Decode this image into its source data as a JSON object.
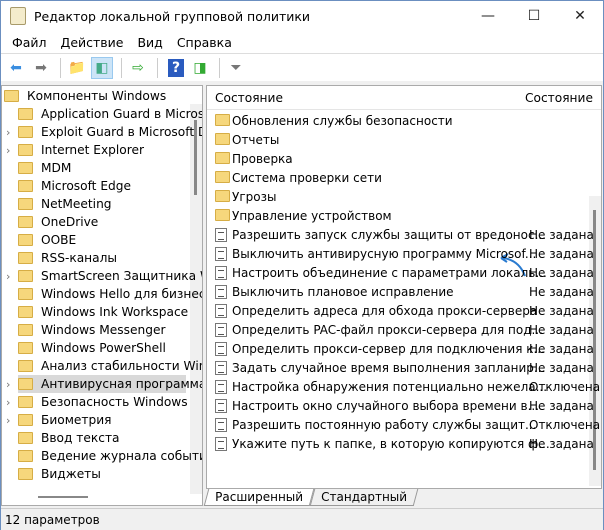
{
  "window": {
    "title": "Редактор локальной групповой политики"
  },
  "menu": [
    "Файл",
    "Действие",
    "Вид",
    "Справка"
  ],
  "toolbar": [
    "back-icon",
    "forward-icon",
    "up-folder-icon",
    "show-hide-tree-icon",
    "export-list-icon",
    "help-icon",
    "show-hide-action-pane-icon",
    "filter-icon"
  ],
  "tree": {
    "root": "Компоненты Windows",
    "items": [
      {
        "label": "Application Guard в Microsoft Defender",
        "expandable": false
      },
      {
        "label": "Exploit Guard в Microsoft Defender",
        "expandable": true
      },
      {
        "label": "Internet Explorer",
        "expandable": true
      },
      {
        "label": "MDM",
        "expandable": false
      },
      {
        "label": "Microsoft Edge",
        "expandable": false
      },
      {
        "label": "NetMeeting",
        "expandable": false
      },
      {
        "label": "OneDrive",
        "expandable": false
      },
      {
        "label": "OOBE",
        "expandable": false
      },
      {
        "label": "RSS-каналы",
        "expandable": false
      },
      {
        "label": "SmartScreen Защитника Windows",
        "expandable": true
      },
      {
        "label": "Windows Hello для бизнеса",
        "expandable": false
      },
      {
        "label": "Windows Ink Workspace",
        "expandable": false
      },
      {
        "label": "Windows Messenger",
        "expandable": false
      },
      {
        "label": "Windows PowerShell",
        "expandable": false
      },
      {
        "label": "Анализ стабильности Windows",
        "expandable": false
      },
      {
        "label": "Антивирусная программа",
        "expandable": true,
        "selected": true
      },
      {
        "label": "Безопасность Windows",
        "expandable": true
      },
      {
        "label": "Биометрия",
        "expandable": true
      },
      {
        "label": "Ввод текста",
        "expandable": false
      },
      {
        "label": "Ведение журнала событий",
        "expandable": false
      },
      {
        "label": "Виджеты",
        "expandable": false
      }
    ]
  },
  "list": {
    "col_name": "Состояние",
    "col_state": "Состояние",
    "folders": [
      "Обновления службы безопасности",
      "Отчеты",
      "Проверка",
      "Система проверки сети",
      "Угрозы",
      "Управление устройством"
    ],
    "settings": [
      {
        "name": "Разрешить запуск службы защиты от вредонос...",
        "state": "Не задана"
      },
      {
        "name": "Выключить антивирусную программу Microsof...",
        "state": "Не задана"
      },
      {
        "name": "Настроить объединение с параметрами локаль...",
        "state": "Не задана"
      },
      {
        "name": "Выключить плановое исправление",
        "state": "Не задана"
      },
      {
        "name": "Определить адреса для обхода прокси-сервера",
        "state": "Не задана"
      },
      {
        "name": "Определить PAC-файл прокси-сервера для под...",
        "state": "Не задана"
      },
      {
        "name": "Определить прокси-сервер для подключения к...",
        "state": "Не задана"
      },
      {
        "name": "Задать случайное время выполнения запланир...",
        "state": "Не задана"
      },
      {
        "name": "Настройка обнаружения потенциально нежела...",
        "state": "Отключена"
      },
      {
        "name": "Настроить окно случайного выбора времени в...",
        "state": "Не задана"
      },
      {
        "name": "Разрешить постоянную работу службы защит...",
        "state": "Отключена"
      },
      {
        "name": "Укажите путь к папке, в которую копируются ф...",
        "state": "Не задана"
      }
    ]
  },
  "tabs": [
    "Расширенный",
    "Стандартный"
  ],
  "status": "12 параметров",
  "annotation_color": "#2a7bd0"
}
